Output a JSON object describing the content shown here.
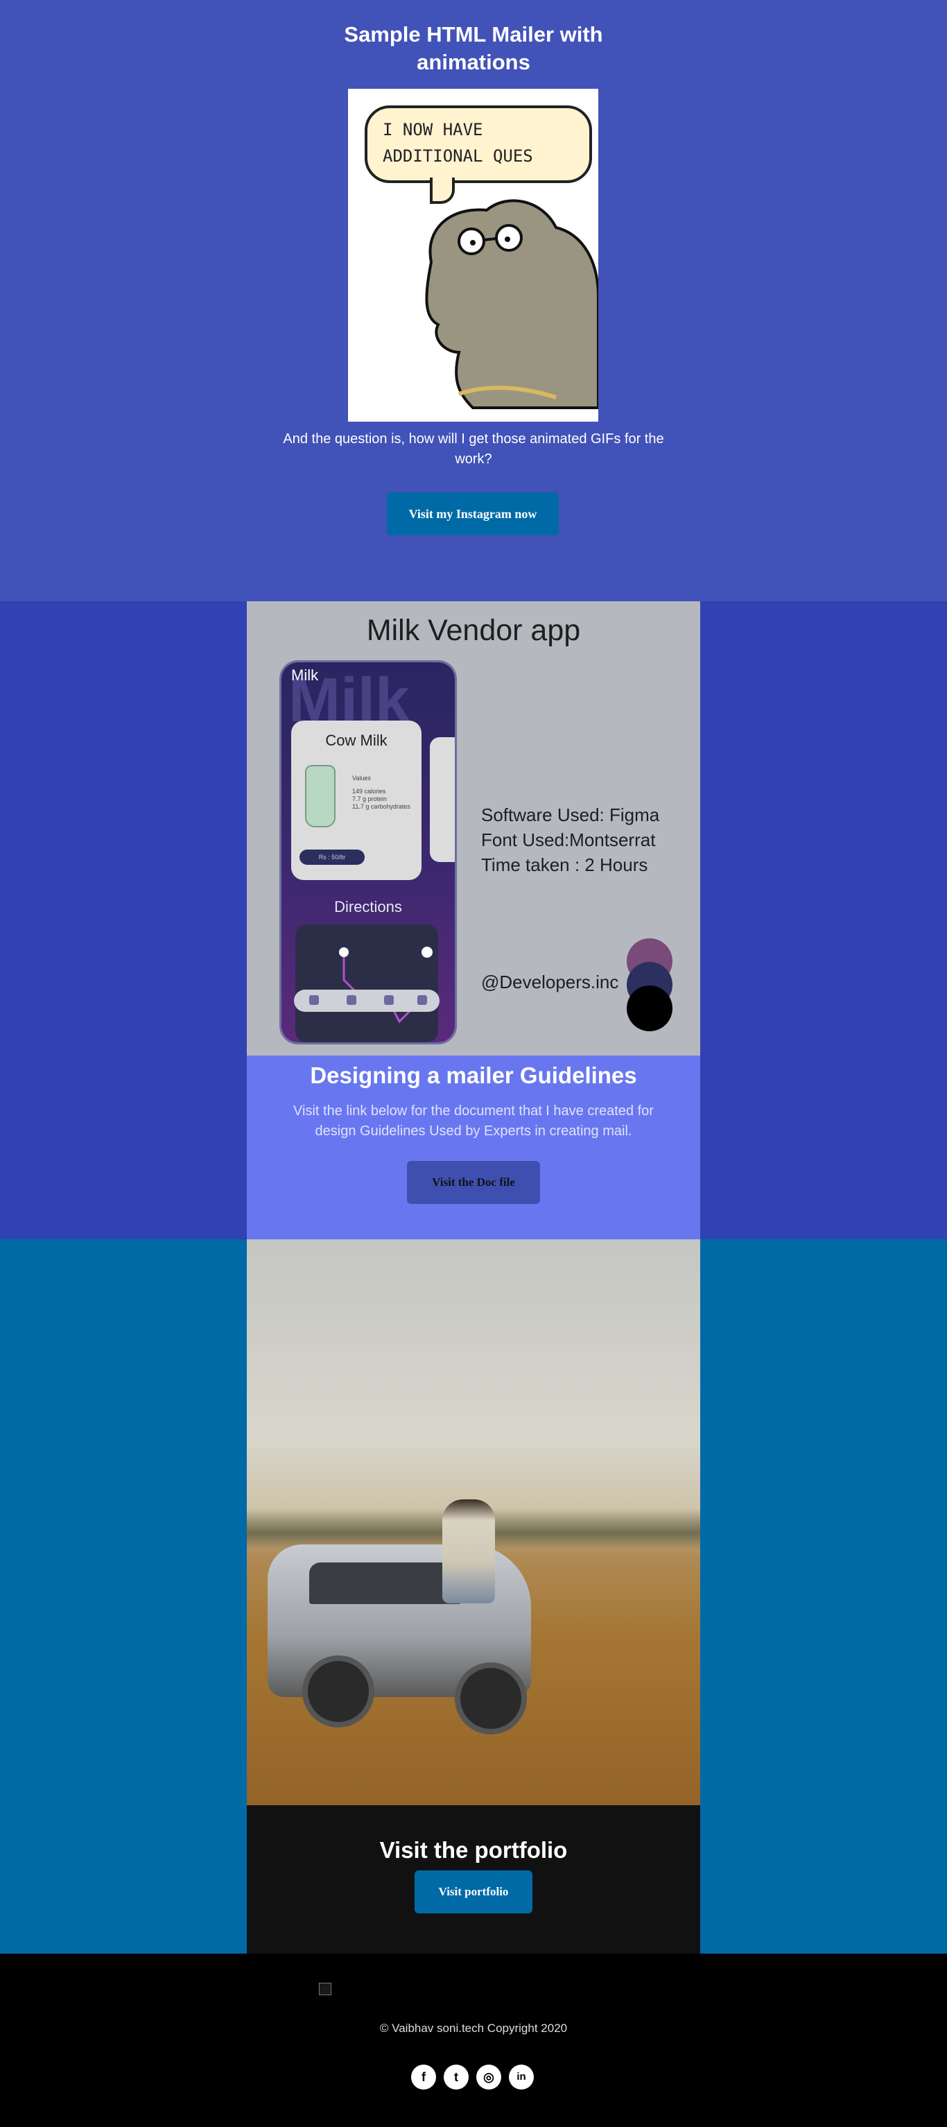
{
  "hero": {
    "title": "Sample HTML Mailer with animations",
    "gif_speech": [
      "I NOW HAVE",
      "ADDITIONAL QUES"
    ],
    "question": "And the question is, how will I get those animated GIFs for the work?",
    "button": "Visit my Instagram now"
  },
  "milk": {
    "title": "Milk Vendor app",
    "phone_label": "Milk",
    "phone_watermark": "Milk",
    "card_title": "Cow Milk",
    "card_info": [
      "Values",
      "149 calories",
      "7.7 g protein",
      "11.7 g carbohydrates"
    ],
    "price": "Rs : 50/ltr",
    "directions": "Directions",
    "specs": [
      "Software Used: Figma",
      "Font Used:Montserrat",
      "Time taken : 2 Hours"
    ],
    "handle": "@Developers.inc",
    "swatches": [
      "#7a4a78",
      "#2c3060",
      "#000000"
    ]
  },
  "guide": {
    "title": "Designing a mailer Guidelines",
    "text": "Visit the link below for the document that I have created for design Guidelines Used by Experts in creating mail.",
    "button": "Visit the Doc file"
  },
  "portfolio": {
    "title": "Visit the portfolio",
    "button": "Visit portfolio"
  },
  "footer": {
    "copyright": "© Vaibhav soni.tech Copyright 2020",
    "social": [
      {
        "icon": "facebook-icon",
        "glyph": "f"
      },
      {
        "icon": "twitter-icon",
        "glyph": "t"
      },
      {
        "icon": "instagram-icon",
        "glyph": "◎"
      },
      {
        "icon": "linkedin-icon",
        "glyph": "in"
      }
    ]
  },
  "colors": {
    "hero_bg": "#4152b8",
    "milk_band_bg": "#3142b2",
    "guide_bg": "#6877f0",
    "photo_band_bg": "#006aa7",
    "button_blue": "#006aa7",
    "footer_bg": "#000000"
  }
}
